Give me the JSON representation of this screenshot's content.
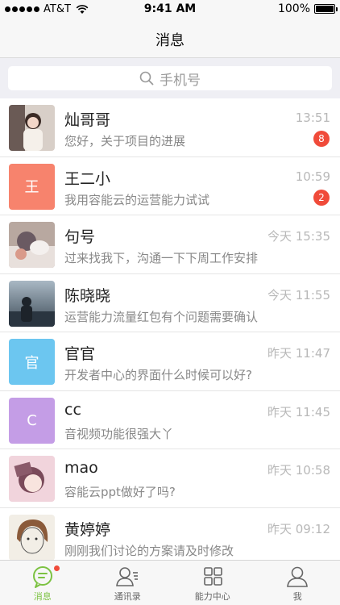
{
  "status_bar": {
    "carrier": "AT&T",
    "time": "9:41 AM",
    "battery": "100%"
  },
  "nav": {
    "title": "消息"
  },
  "search": {
    "placeholder": "手机号"
  },
  "conversations": [
    {
      "name": "灿哥哥",
      "preview": "您好，关于项目的进展",
      "time": "13:51",
      "badge": "8",
      "avatar_text": "",
      "avatar_color": "#c9b6a8"
    },
    {
      "name": "王二小",
      "preview": "我用容能云的运营能力试试",
      "time": "10:59",
      "badge": "2",
      "avatar_text": "王",
      "avatar_color": "#f7836d"
    },
    {
      "name": "句号",
      "preview": "过来找我下，沟通一下下周工作安排",
      "time": "今天 15:35",
      "badge": "",
      "avatar_text": "",
      "avatar_color": "#8a7a8a"
    },
    {
      "name": "陈晓晓",
      "preview": "运营能力流量红包有个问题需要确认",
      "time": "今天 11:55",
      "badge": "",
      "avatar_text": "",
      "avatar_color": "#4a5a6a"
    },
    {
      "name": "官官",
      "preview": "开发者中心的界面什么时候可以好?",
      "time": "昨天 11:47",
      "badge": "",
      "avatar_text": "官",
      "avatar_color": "#6cc6f0"
    },
    {
      "name": "cc",
      "preview": "音视频功能很强大丫",
      "time": "昨天 11:45",
      "badge": "",
      "avatar_text": "C",
      "avatar_color": "#c49de6"
    },
    {
      "name": "mao",
      "preview": "容能云ppt做好了吗?",
      "time": "昨天 10:58",
      "badge": "",
      "avatar_text": "",
      "avatar_color": "#e8b8c8"
    },
    {
      "name": "黄婷婷",
      "preview": "刚刚我们讨论的方案请及时修改",
      "time": "昨天 09:12",
      "badge": "",
      "avatar_text": "",
      "avatar_color": "#f2eee6"
    }
  ],
  "tabs": [
    {
      "label": "消息",
      "icon": "chat-bubble-icon",
      "active": true
    },
    {
      "label": "通讯录",
      "icon": "contacts-icon",
      "active": false
    },
    {
      "label": "能力中心",
      "icon": "grid-icon",
      "active": false
    },
    {
      "label": "我",
      "icon": "person-icon",
      "active": false
    }
  ],
  "colors": {
    "accent": "#7cc242",
    "badge": "#f04b3a"
  }
}
